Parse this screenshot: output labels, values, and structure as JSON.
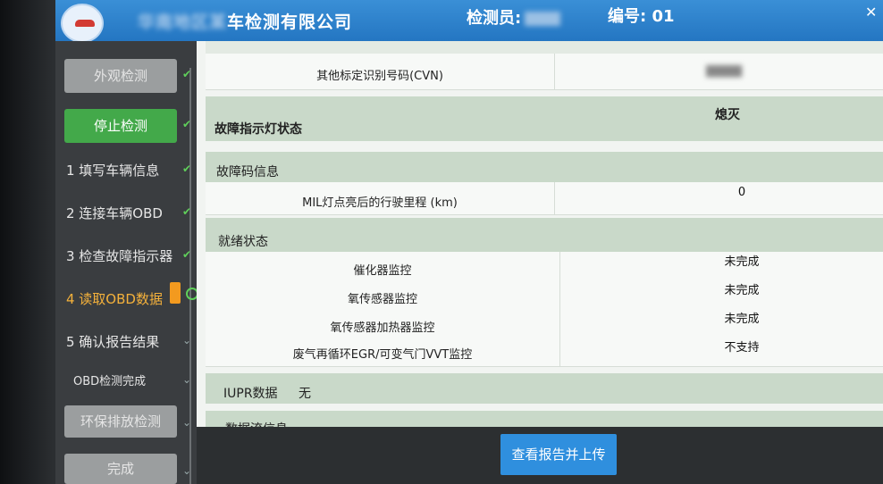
{
  "header": {
    "company_blur": "华南地区某",
    "company_suffix": "车检测有限公司",
    "inspector_label": "检测员:",
    "number_label": "编号: 01"
  },
  "sidebar": {
    "buttons": [
      {
        "label": "外观检测"
      },
      {
        "label": "停止检测"
      },
      {
        "label": "环保排放检测"
      },
      {
        "label": "完成"
      }
    ],
    "steps": [
      {
        "label": "1 填写车辆信息"
      },
      {
        "label": "2 连接车辆OBD"
      },
      {
        "label": "3 检查故障指示器"
      },
      {
        "label": "4 读取OBD数据"
      },
      {
        "label": "5 确认报告结果"
      },
      {
        "label": "OBD检测完成"
      }
    ]
  },
  "content": {
    "cvn_label": "其他标定识别号码(CVN)",
    "mil_section": "故障指示灯状态",
    "mil_value": "熄灭",
    "dtc_section": "故障码信息",
    "mil_mileage_label": "MIL灯点亮后的行驶里程 (km)",
    "mil_mileage_value": "0",
    "ready_section": "就绪状态",
    "ready_rows": [
      {
        "name": "催化器监控",
        "value": "未完成"
      },
      {
        "name": "氧传感器监控",
        "value": "未完成"
      },
      {
        "name": "氧传感器加热器监控",
        "value": "未完成"
      },
      {
        "name": "废气再循环EGR/可变气门VVT监控",
        "value": "不支持"
      }
    ],
    "iupr_label": "IUPR数据",
    "iupr_value": "无",
    "stream_section": "数据流信息"
  },
  "footer": {
    "upload_label": "查看报告并上传"
  }
}
